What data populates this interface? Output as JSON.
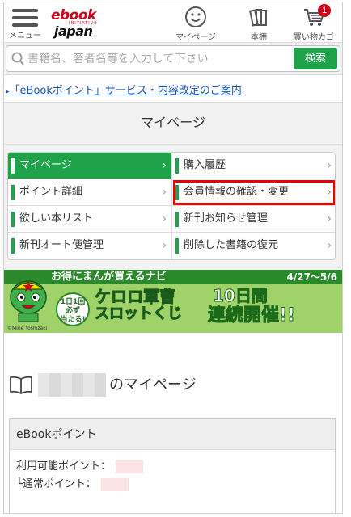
{
  "header": {
    "menu_label": "メニュー",
    "logo_main": "ebook",
    "logo_sub": "INITIATIVE",
    "logo_bottom": "japan",
    "mypage_label": "マイページ",
    "shelf_label": "本棚",
    "cart_label": "買い物カゴ",
    "cart_count": "1"
  },
  "search": {
    "placeholder": "書籍名、著者名等を入力して下さい",
    "button_label": "検索"
  },
  "notice": {
    "link_text": "「eBookポイント」サービス・内容改定のご案内"
  },
  "page_title": "マイページ",
  "menu": {
    "items": [
      {
        "label": "マイページ"
      },
      {
        "label": "購入履歴"
      },
      {
        "label": "ポイント詳細"
      },
      {
        "label": "会員情報の確認・変更"
      },
      {
        "label": "欲しい本リスト"
      },
      {
        "label": "新刊お知らせ管理"
      },
      {
        "label": "新刊オート便管理"
      },
      {
        "label": "削除した書籍の復元"
      }
    ],
    "chevron": "›"
  },
  "banner": {
    "headline": "お得にまんが買えるナビ",
    "dates": "4/27～5/6",
    "badge_line1": "1日1回",
    "badge_line2": "必ず",
    "badge_line3": "当たる!",
    "game_title_1": "ケロロ軍曹",
    "game_title_2": "スロットくじ",
    "ten_days": "10日間",
    "renzoku": "連続開催!!",
    "copyright": "©Mine Yoshizaki"
  },
  "mypage_section": {
    "title": "のマイページ",
    "points_heading": "eBookポイント",
    "available_label": "利用可能ポイント：",
    "normal_label": "└通常ポイント："
  },
  "colors": {
    "accent_green": "#1ea24a",
    "brand_red": "#d0021b",
    "highlight_red": "#e00000"
  }
}
